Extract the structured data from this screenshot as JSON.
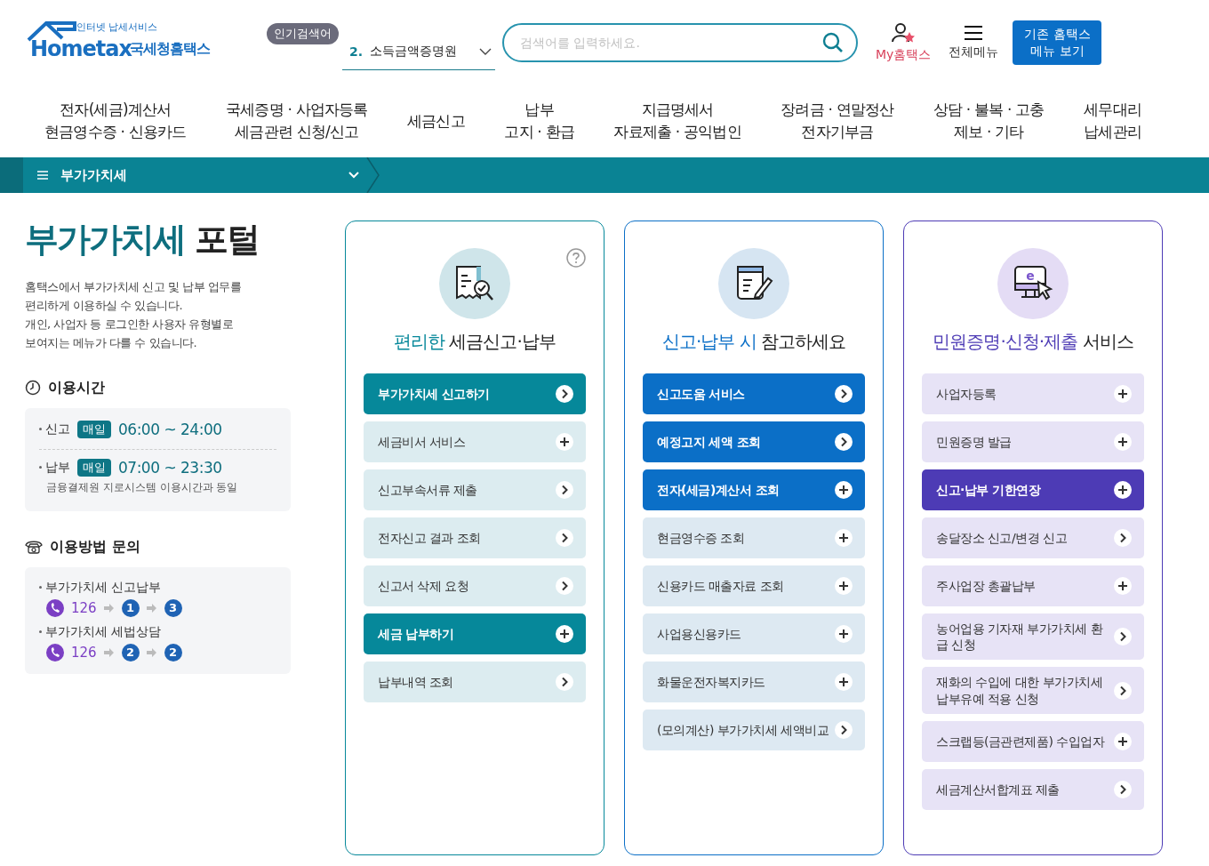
{
  "header": {
    "logo_tagline": "인터넷 납세서비스",
    "logo_word": "Hometax",
    "logo_name": "국세청홈택스",
    "popular_badge": "인기검색어",
    "popular_rank": "2.",
    "popular_term": "소득금액증명원",
    "search": {
      "placeholder": "검색어를 입력하세요."
    },
    "my_label": "My홈택스",
    "menu_label": "전체메뉴",
    "legacy_button": [
      "기존 홈택스",
      "메뉴 보기"
    ]
  },
  "nav": [
    [
      "전자(세금)계산서",
      "현금영수증 · 신용카드"
    ],
    [
      "국세증명 · 사업자등록",
      "세금관련 신청/신고"
    ],
    [
      "세금신고"
    ],
    [
      "납부",
      "고지 · 환급"
    ],
    [
      "지급명세서",
      "자료제출 · 공익법인"
    ],
    [
      "장려금 · 연말정산",
      "전자기부금"
    ],
    [
      "상담 · 불복 · 고충",
      "제보 · 기타"
    ],
    [
      "세무대리",
      "납세관리"
    ]
  ],
  "breadcrumb": {
    "label": "부가가치세"
  },
  "intro": {
    "title_accent": "부가가치세",
    "title_rest": "포털",
    "description": [
      "홈택스에서 부가가치세 신고 및 납부 업무를",
      "편리하게 이용하실 수 있습니다.",
      "개인, 사업자 등 로그인한 사용자 유형별로",
      "보여지는 메뉴가 다를 수 있습니다."
    ]
  },
  "hours": {
    "heading": "이용시간",
    "rows": [
      {
        "label": "신고",
        "badge": "매일",
        "time": "06:00 ~ 24:00"
      },
      {
        "label": "납부",
        "badge": "매일",
        "time": "07:00 ~ 23:30",
        "note": "금융결제원 지로시스템 이용시간과 동일"
      }
    ]
  },
  "contact": {
    "heading": "이용방법 문의",
    "rows": [
      {
        "label": "부가가치세 신고납부",
        "number": "126",
        "steps": [
          "1",
          "3"
        ]
      },
      {
        "label": "부가가치세 세법상담",
        "number": "126",
        "steps": [
          "2",
          "2"
        ]
      }
    ]
  },
  "cards": [
    {
      "color": "#06889a",
      "title_accent": "편리한",
      "title_rest": "세금신고·납부",
      "help": true,
      "items": [
        {
          "label": "부가가치세 신고하기",
          "kind": "arrow",
          "highlighted": true
        },
        {
          "label": "세금비서 서비스",
          "kind": "plus",
          "highlighted": false
        },
        {
          "label": "신고부속서류 제출",
          "kind": "arrow",
          "highlighted": false
        },
        {
          "label": "전자신고 결과 조회",
          "kind": "arrow",
          "highlighted": false
        },
        {
          "label": "신고서 삭제 요청",
          "kind": "arrow",
          "highlighted": false
        },
        {
          "label": "세금 납부하기",
          "kind": "plus",
          "highlighted": true
        },
        {
          "label": "납부내역 조회",
          "kind": "arrow",
          "highlighted": false
        }
      ]
    },
    {
      "color": "#0b6fc7",
      "title_accent": "신고·납부 시",
      "title_rest": "참고하세요",
      "help": false,
      "items": [
        {
          "label": "신고도움 서비스",
          "kind": "arrow",
          "highlighted": true
        },
        {
          "label": "예정고지 세액 조회",
          "kind": "arrow",
          "highlighted": true
        },
        {
          "label": "전자(세금)계산서 조회",
          "kind": "plus",
          "highlighted": true
        },
        {
          "label": "현금영수증 조회",
          "kind": "plus",
          "highlighted": false
        },
        {
          "label": "신용카드 매출자료 조회",
          "kind": "plus",
          "highlighted": false
        },
        {
          "label": "사업용신용카드",
          "kind": "plus",
          "highlighted": false
        },
        {
          "label": "화물운전자복지카드",
          "kind": "plus",
          "highlighted": false
        },
        {
          "label": "(모의계산) 부가가치세 세액비교",
          "kind": "arrow",
          "highlighted": false
        }
      ]
    },
    {
      "color": "#4d3bb5",
      "icon_text": "e",
      "title_accent": "민원증명·신청·제출",
      "title_rest": "서비스",
      "help": false,
      "items": [
        {
          "label": "사업자등록",
          "kind": "plus",
          "highlighted": false
        },
        {
          "label": "민원증명 발급",
          "kind": "plus",
          "highlighted": false
        },
        {
          "label": "신고·납부 기한연장",
          "kind": "plus",
          "highlighted": true
        },
        {
          "label": "송달장소 신고/변경 신고",
          "kind": "arrow",
          "highlighted": false
        },
        {
          "label": "주사업장 총괄납부",
          "kind": "plus",
          "highlighted": false
        },
        {
          "label": "농어업용 기자재 부가가치세 환급 신청",
          "kind": "arrow",
          "highlighted": false
        },
        {
          "label": "재화의 수입에 대한 부가가치세 납부유예 적용 신청",
          "kind": "arrow",
          "highlighted": false
        },
        {
          "label": "스크랩등(금관련제품) 수입업자",
          "kind": "plus",
          "highlighted": false
        },
        {
          "label": "세금계산서합계표 제출",
          "kind": "arrow",
          "highlighted": false
        }
      ]
    }
  ]
}
